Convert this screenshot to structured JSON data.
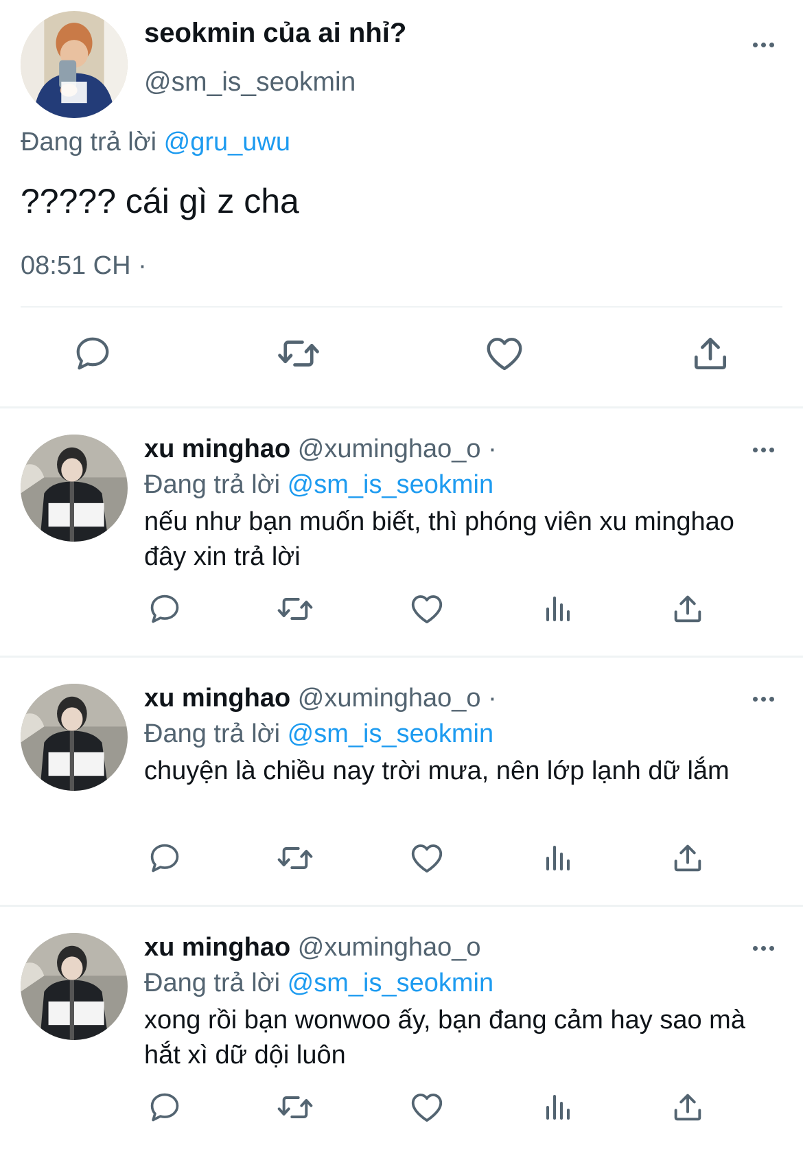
{
  "main_tweet": {
    "display_name": "seokmin của ai nhỉ?",
    "handle": "@sm_is_seokmin",
    "replying_prefix": "Đang trả lời",
    "replying_to": "@gru_uwu",
    "text": "????? cái gì z cha",
    "timestamp": "08:51 CH ·",
    "actions": [
      "reply-icon",
      "retweet-icon",
      "like-icon",
      "share-icon"
    ]
  },
  "replies": [
    {
      "display_name": "xu minghao",
      "handle": "@xuminghao_o",
      "separator": "·",
      "replying_prefix": "Đang trả lời",
      "replying_to": "@sm_is_seokmin",
      "text": "nếu như bạn muốn biết, thì phóng viên xu minghao đây xin trả lời"
    },
    {
      "display_name": "xu minghao",
      "handle": "@xuminghao_o",
      "separator": "·",
      "replying_prefix": "Đang trả lời",
      "replying_to": "@sm_is_seokmin",
      "text": "chuyện là chiều nay trời mưa, nên lớp lạnh dữ lắm"
    },
    {
      "display_name": "xu minghao",
      "handle": "@xuminghao_o",
      "separator": "",
      "replying_prefix": "Đang trả lời",
      "replying_to": "@sm_is_seokmin",
      "text": "xong rồi bạn wonwoo ấy, bạn đang cảm hay sao mà hắt xì dữ dội luôn"
    }
  ],
  "reply_actions": [
    "reply-icon",
    "retweet-icon",
    "like-icon",
    "analytics-icon",
    "share-icon"
  ],
  "colors": {
    "link": "#1d9bf0",
    "muted": "#536471",
    "text": "#0f1419",
    "divider": "#eff3f4"
  }
}
